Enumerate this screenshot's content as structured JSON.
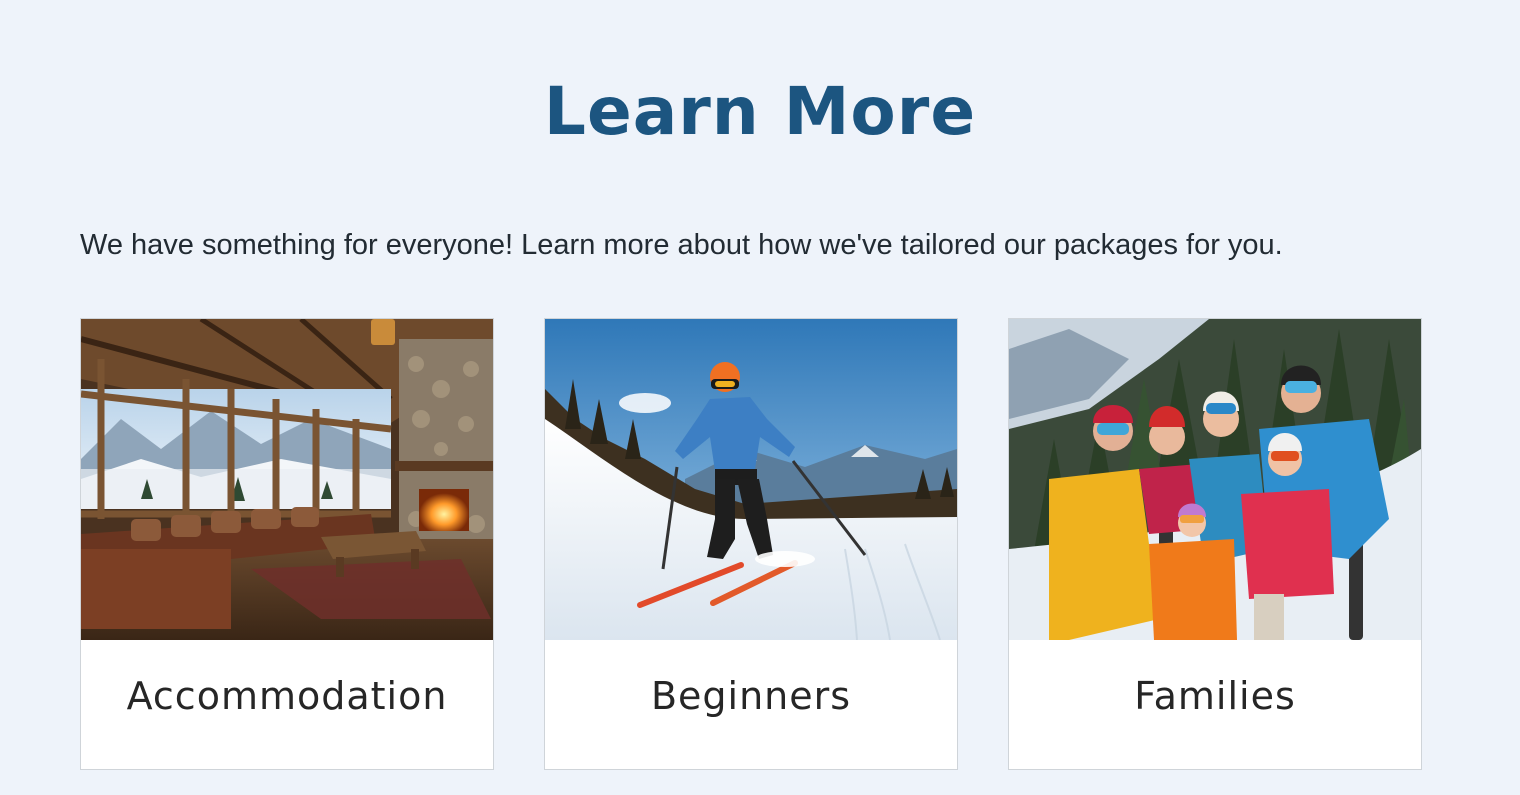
{
  "section": {
    "title": "Learn More",
    "intro": "We have something for everyone! Learn more about how we've tailored our packages for you."
  },
  "cards": [
    {
      "label": "Accommodation",
      "image": "ski-lodge-living-room-photo"
    },
    {
      "label": "Beginners",
      "image": "skier-on-slope-photo"
    },
    {
      "label": "Families",
      "image": "family-in-ski-gear-photo"
    }
  ],
  "colors": {
    "background": "#eef3fa",
    "title": "#1c5580",
    "text": "#222b33",
    "card_border": "#cfd4d9"
  }
}
